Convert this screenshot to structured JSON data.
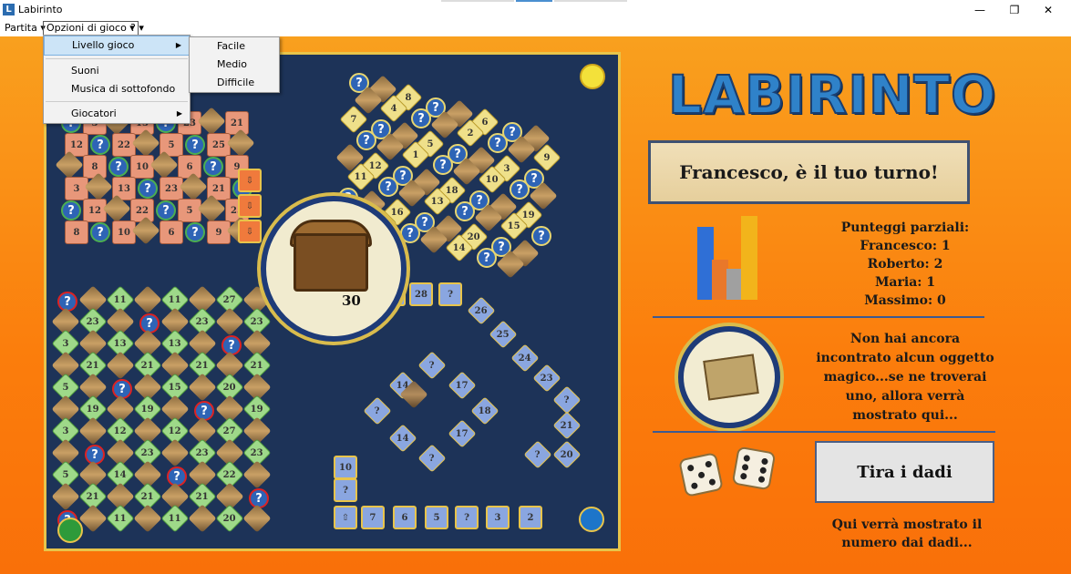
{
  "window": {
    "title": "Labirinto",
    "icon_letter": "L"
  },
  "window_controls": {
    "minimize": "—",
    "maximize": "❐",
    "close": "✕"
  },
  "menubar": {
    "items": [
      "Partita",
      "Opzioni di gioco",
      "?"
    ]
  },
  "options_menu": {
    "items": [
      "Livello gioco",
      "Suoni",
      "Musica di sottofondo",
      "Giocatori"
    ]
  },
  "level_submenu": {
    "items": [
      "Facile",
      "Medio",
      "Difficile"
    ]
  },
  "game": {
    "logo": "LABIRINTO",
    "turn_message": "Francesco, è il tuo turno!",
    "scores_title": "Punteggi parziali:",
    "scores": [
      {
        "text": "Francesco: 1"
      },
      {
        "text": "Roberto: 2"
      },
      {
        "text": "Maria: 1"
      },
      {
        "text": "Massimo: 0"
      }
    ],
    "magic_object_message": "Non hai ancora incontrato alcun oggetto magico...se ne troverai uno, allora verrà mostrato qui...",
    "roll_button": "Tira i dadi",
    "dice_message": "Qui verrà mostrato il numero dai dadi...",
    "treasure_value": "30",
    "colors": {
      "board": "#1d3358",
      "background": "#fb8a10",
      "gold": "#e8c44a",
      "accent_blue": "#2f82c9"
    },
    "board_numbers": {
      "bottom_path": [
        "7",
        "6",
        "5",
        "3",
        "2"
      ],
      "left_path": [
        "10"
      ],
      "right_path": [
        "28",
        "26",
        "25",
        "24",
        "23",
        "21",
        "20"
      ],
      "green_column1": [
        "5",
        "4",
        "3",
        "1"
      ],
      "green_column2": [
        "11",
        "12",
        "13",
        "14",
        "15"
      ],
      "green_column3": [
        "27",
        "23",
        "22",
        "21",
        "20",
        "19"
      ],
      "inner_diamond": [
        "14",
        "17",
        "18",
        "17",
        "14"
      ],
      "top_right": [
        "8",
        "6",
        "4",
        "2",
        "9",
        "7",
        "5",
        "3",
        "1",
        "10",
        "12",
        "18",
        "19",
        "11",
        "13",
        "15",
        "16",
        "20",
        "21",
        "14",
        "26",
        "24",
        "22",
        "23",
        "25"
      ],
      "top_left": [
        "3",
        "13",
        "23",
        "21",
        "12",
        "22",
        "5",
        "25",
        "8",
        "10",
        "6",
        "9"
      ]
    }
  }
}
